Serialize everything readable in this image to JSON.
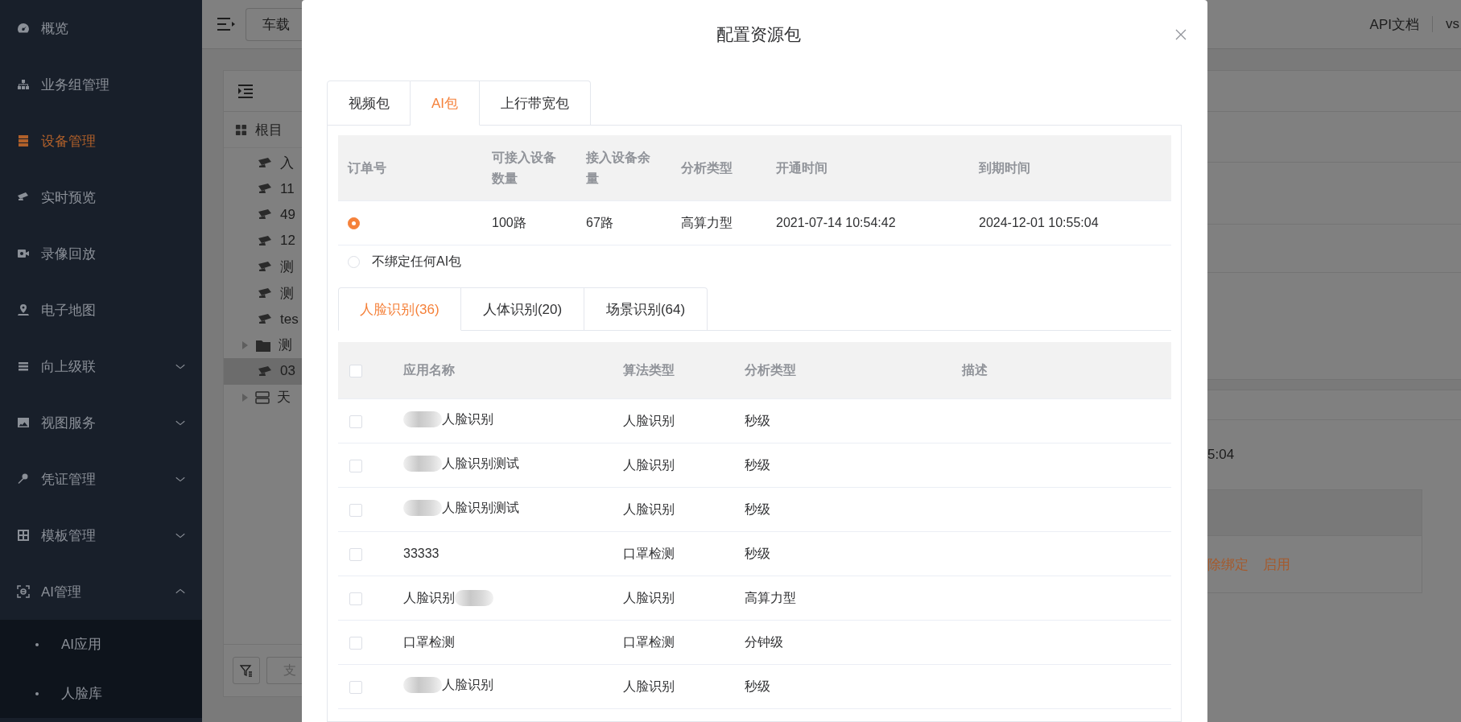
{
  "sidebar": {
    "items": [
      {
        "label": "概览",
        "selected": false
      },
      {
        "label": "业务组管理",
        "selected": false
      },
      {
        "label": "设备管理",
        "selected": true
      },
      {
        "label": "实时预览",
        "selected": false
      },
      {
        "label": "录像回放",
        "selected": false
      },
      {
        "label": "电子地图",
        "selected": false
      },
      {
        "label": "向上级联",
        "selected": false,
        "expanded": false
      },
      {
        "label": "视图服务",
        "selected": false,
        "expanded": false
      },
      {
        "label": "凭证管理",
        "selected": false,
        "expanded": false
      },
      {
        "label": "模板管理",
        "selected": false,
        "expanded": false
      },
      {
        "label": "AI管理",
        "selected": false,
        "expanded": true,
        "children": [
          {
            "label": "AI应用",
            "selected": false
          },
          {
            "label": "人脸库",
            "selected": false
          }
        ]
      }
    ]
  },
  "header": {
    "device_button": "车载"
  },
  "tree": {
    "root": "根目",
    "items": [
      {
        "label": "入",
        "kind": "camera",
        "selected": false
      },
      {
        "label": "11",
        "kind": "camera",
        "selected": false
      },
      {
        "label": "49",
        "kind": "camera",
        "selected": false
      },
      {
        "label": "12",
        "kind": "camera",
        "selected": false
      },
      {
        "label": "测",
        "kind": "camera",
        "selected": false
      },
      {
        "label": "测",
        "kind": "camera",
        "selected": false
      },
      {
        "label": "tes",
        "kind": "camera",
        "selected": false
      },
      {
        "label": "测",
        "kind": "folder",
        "selected": false
      },
      {
        "label": "03",
        "kind": "camera",
        "selected": true
      },
      {
        "label": "天",
        "kind": "server",
        "selected": false
      }
    ]
  },
  "bottom_field": {
    "placeholder": "支"
  },
  "top_right": {
    "api_link": "API文档",
    "user": "vs"
  },
  "background_detail": {
    "time_fragment": "5:04",
    "actions": [
      "除绑定",
      "启用"
    ]
  },
  "modal": {
    "title": "配置资源包",
    "tabs": [
      {
        "label": "视频包",
        "selected": false
      },
      {
        "label": "AI包",
        "selected": true
      },
      {
        "label": "上行带宽包",
        "selected": false
      }
    ],
    "package_table": {
      "columns": [
        "订单号",
        "可接入设备数量",
        "接入设备余量",
        "分析类型",
        "开通时间",
        "到期时间"
      ],
      "rows": [
        {
          "selected": true,
          "cells": [
            "",
            "100路",
            "67路",
            "高算力型",
            "2021-07-14 10:54:42",
            "2024-12-01 10:55:04"
          ]
        }
      ]
    },
    "no_bind_option": {
      "label": "不绑定任何AI包",
      "selected": false
    },
    "sub_tabs": [
      {
        "label": "人脸识别(36)",
        "selected": true
      },
      {
        "label": "人体识别(20)",
        "selected": false
      },
      {
        "label": "场景识别(64)",
        "selected": false
      }
    ],
    "app_table": {
      "columns": [
        "应用名称",
        "算法类型",
        "分析类型",
        "描述"
      ],
      "all_checked": false,
      "rows": [
        {
          "name": "人脸识别",
          "algorithm": "人脸识别",
          "analysis": "秒级",
          "checked": false
        },
        {
          "name": "人脸识别测试",
          "algorithm": "人脸识别",
          "analysis": "秒级",
          "checked": false
        },
        {
          "name": "人脸识别测试",
          "algorithm": "人脸识别",
          "analysis": "秒级",
          "checked": false
        },
        {
          "name": "33333",
          "algorithm": "口罩检测",
          "analysis": "秒级",
          "checked": false
        },
        {
          "name": "人脸识别",
          "algorithm": "人脸识别",
          "analysis": "高算力型",
          "checked": false
        },
        {
          "name": "口罩检测",
          "algorithm": "口罩检测",
          "analysis": "分钟级",
          "checked": false
        },
        {
          "name": "人脸识别",
          "algorithm": "人脸识别",
          "analysis": "秒级",
          "checked": false
        }
      ]
    }
  }
}
